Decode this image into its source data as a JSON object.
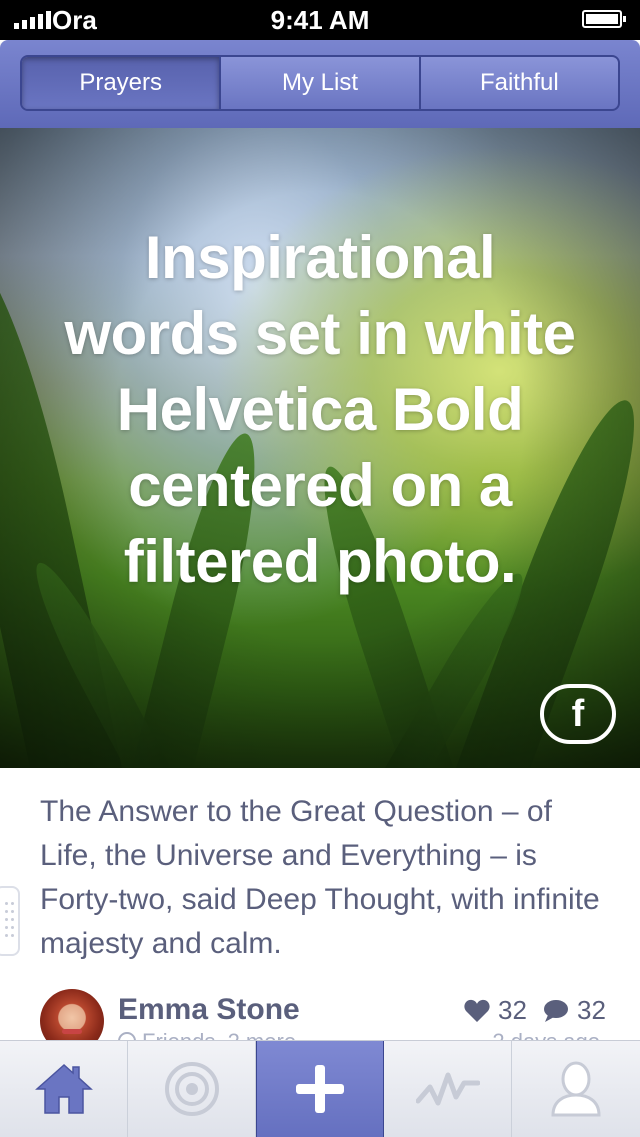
{
  "status_bar": {
    "carrier": "Ora",
    "time": "9:41 AM"
  },
  "header": {
    "tabs": [
      {
        "label": "Prayers",
        "active": true
      },
      {
        "label": "My List",
        "active": false
      },
      {
        "label": "Faithful",
        "active": false
      }
    ]
  },
  "hero": {
    "quote": "Inspirational words set in white Helvetica Bold centered on a filtered photo.",
    "share_icon": "facebook-icon"
  },
  "post": {
    "caption": "The Answer to the Great Question – of Life, the Universe and Everything – is Forty-two, said Deep Thought, with infinite majesty and calm.",
    "author": {
      "name": "Emma Stone",
      "audience": "Friends, 2 more"
    },
    "likes": "32",
    "comments": "32",
    "time_ago": "2 days ago"
  },
  "tabbar": {
    "items": [
      {
        "icon": "home-icon",
        "active": false
      },
      {
        "icon": "target-icon",
        "active": false
      },
      {
        "icon": "plus-icon",
        "active": true
      },
      {
        "icon": "activity-icon",
        "active": false
      },
      {
        "icon": "person-icon",
        "active": false
      }
    ]
  },
  "colors": {
    "accent": "#6a75c2",
    "text": "#5a5f7c",
    "muted": "#aab0c4"
  }
}
